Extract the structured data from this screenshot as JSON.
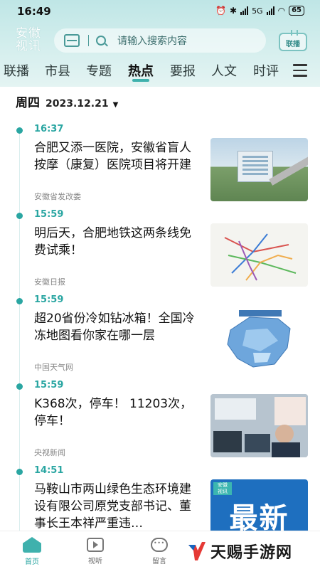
{
  "status": {
    "time": "16:49",
    "network": "5G",
    "battery": "65"
  },
  "header": {
    "logo_line1": "安徽",
    "logo_line2": "视讯",
    "search_placeholder": "请输入搜索内容",
    "tv_label": "联播"
  },
  "tabs": [
    {
      "label": "联播",
      "active": false
    },
    {
      "label": "市县",
      "active": false
    },
    {
      "label": "专题",
      "active": false
    },
    {
      "label": "热点",
      "active": true
    },
    {
      "label": "要报",
      "active": false
    },
    {
      "label": "人文",
      "active": false
    },
    {
      "label": "时评",
      "active": false
    }
  ],
  "date": {
    "weekday": "周四",
    "date": "2023.12.21"
  },
  "feed": [
    {
      "time": "16:37",
      "title": "合肥又添一医院，安徽省盲人按摩（康复）医院项目将开建",
      "source": "安徽省发改委",
      "thumb": "hospital-photo"
    },
    {
      "time": "15:59",
      "title": "明后天，合肥地铁这两条线免费试乘！",
      "source": "安徽日报",
      "thumb": "metro-map"
    },
    {
      "time": "15:59",
      "title": "超20省份冷如钻冰箱！全国冷冻地图看你家在哪一层",
      "source": "中国天气网",
      "thumb": "cold-map"
    },
    {
      "time": "15:59",
      "title": "K368次，停车！ 11203次，停车！",
      "source": "央视新闻",
      "thumb": "railway-office"
    },
    {
      "time": "14:51",
      "title": "马鞍山市两山绿色生态环境建设有限公司原党支部书记、董事长王本祥严重违…",
      "source": "",
      "thumb": "latest-news",
      "thumb_badge_line1": "安徽",
      "thumb_badge_line2": "视讯",
      "thumb_text": "最新"
    }
  ],
  "bottom_nav": [
    {
      "label": "首页",
      "icon": "home-icon",
      "active": true
    },
    {
      "label": "视听",
      "icon": "video-icon",
      "active": false
    },
    {
      "label": "留言",
      "icon": "message-icon",
      "active": false
    }
  ],
  "watermark": {
    "text": "天赐手游网"
  },
  "colors": {
    "accent": "#2aa6a2",
    "header_bg": "#c9eaea"
  }
}
